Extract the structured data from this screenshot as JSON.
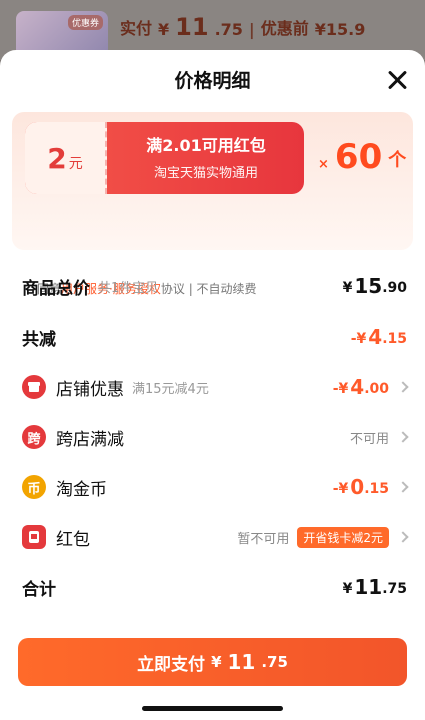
{
  "header": {
    "thumb_badge": "优惠券",
    "paid_label": "实付",
    "paid_yen": "¥",
    "paid_int": "11",
    "paid_dec": ".75",
    "separator": "|",
    "original_label": "优惠前",
    "original_price": "¥15.9"
  },
  "sheet": {
    "title": "价格明细"
  },
  "promo": {
    "coupon_amount": "2",
    "coupon_unit": "元",
    "coupon_title": "满2.01可用红包",
    "coupon_sub": "淘宝天猫实物通用",
    "multiplier_x": "×",
    "multiplier_count": "60",
    "multiplier_unit": "个",
    "agree_prefix": "同意",
    "agree_link1": "用户服务",
    "agree_dot": "·",
    "agree_link2": "服务授权",
    "agree_suffix": "协议 | 不自动续费"
  },
  "rows": {
    "total": {
      "label": "商品总价",
      "hint": "共1件宝贝",
      "yen": "¥",
      "int": "15",
      "dec": ".90"
    },
    "reduce": {
      "label": "共减",
      "prefix": "-",
      "yen": "¥",
      "int": "4",
      "dec": ".15"
    },
    "store": {
      "label": "店铺优惠",
      "hint": "满15元减4元",
      "prefix": "-",
      "yen": "¥",
      "int": "4",
      "dec": ".00"
    },
    "cross": {
      "label": "跨店满减",
      "icon_text": "跨",
      "value": "不可用"
    },
    "coins": {
      "label": "淘金币",
      "icon_text": "币",
      "prefix": "-",
      "yen": "¥",
      "int": "0",
      "dec": ".15"
    },
    "redpacket": {
      "label": "红包",
      "value": "暂不可用",
      "tag": "开省钱卡减2元"
    },
    "sum": {
      "label": "合计",
      "yen": "¥",
      "int": "11",
      "dec": ".75"
    }
  },
  "pay": {
    "label": "立即支付",
    "yen": "¥",
    "int": "11",
    "dec": ".75"
  },
  "icons": {
    "close": "close-icon",
    "store": "store-icon",
    "cross_store": "cross-store-icon",
    "coin": "coin-icon",
    "red_packet": "red-packet-icon",
    "chevron": "chevron-right-icon"
  },
  "colors": {
    "accent": "#ff5a2a",
    "coupon": "#e7363d"
  }
}
